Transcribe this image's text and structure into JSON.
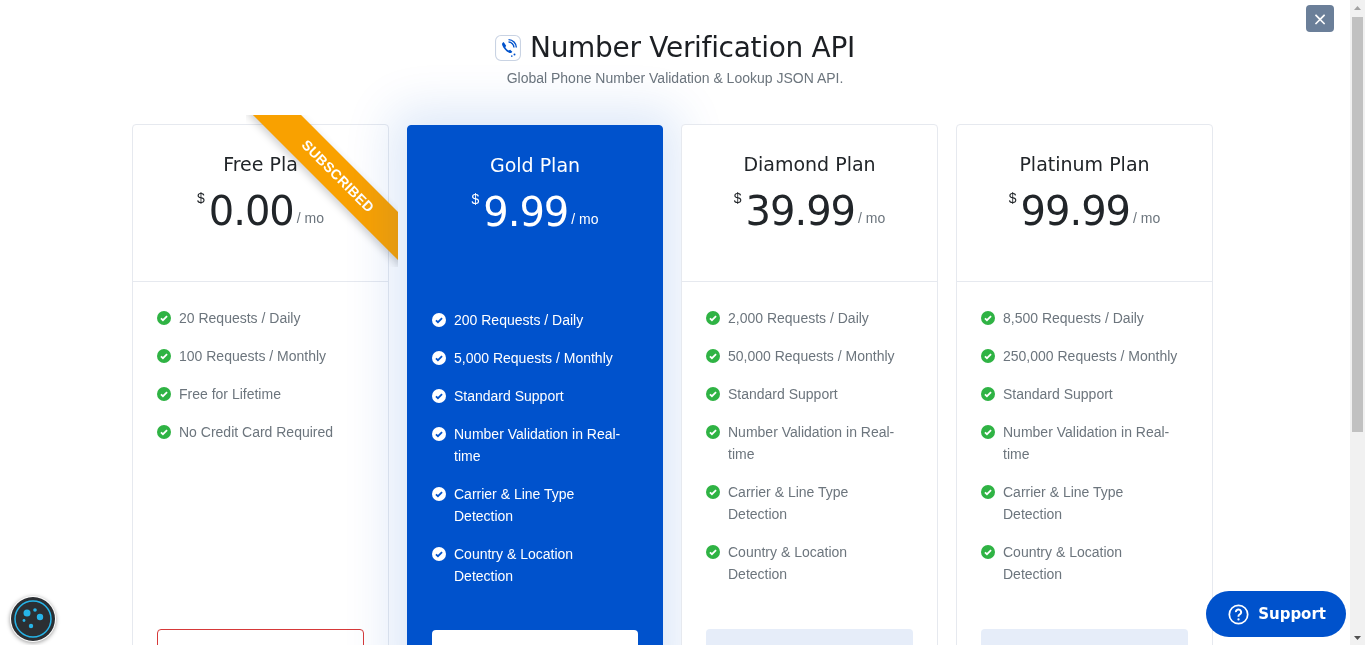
{
  "header": {
    "title": "Number Verification API",
    "subtitle": "Global Phone Number Validation & Lookup JSON API."
  },
  "plans": [
    {
      "name": "Free Pla",
      "currency": "$",
      "price": "0.00",
      "period": "/ mo",
      "featured": false,
      "ribbon": "SUBSCRIBED",
      "button": {
        "kind": "outline"
      },
      "features": [
        "20 Requests / Daily",
        "100 Requests / Monthly",
        "Free for Lifetime",
        "No Credit Card Required"
      ]
    },
    {
      "name": "Gold Plan",
      "currency": "$",
      "price": "9.99",
      "period": "/ mo",
      "featured": true,
      "button": {
        "kind": "white"
      },
      "features": [
        "200 Requests / Daily",
        "5,000 Requests / Monthly",
        "Standard Support",
        "Number Validation in Real-time",
        "Carrier & Line Type Detection",
        "Country & Location Detection"
      ]
    },
    {
      "name": "Diamond Plan",
      "currency": "$",
      "price": "39.99",
      "period": "/ mo",
      "featured": false,
      "button": {
        "kind": "light"
      },
      "features": [
        "2,000 Requests / Daily",
        "50,000 Requests / Monthly",
        "Standard Support",
        "Number Validation in Real-time",
        "Carrier & Line Type Detection",
        "Country & Location Detection"
      ]
    },
    {
      "name": "Platinum Plan",
      "currency": "$",
      "price": "99.99",
      "period": "/ mo",
      "featured": false,
      "button": {
        "kind": "light"
      },
      "features": [
        "8,500 Requests / Daily",
        "250,000 Requests / Monthly",
        "Standard Support",
        "Number Validation in Real-time",
        "Carrier & Line Type Detection",
        "Country & Location Detection"
      ]
    }
  ],
  "close_button": "×",
  "support_button": {
    "label": "Support"
  }
}
